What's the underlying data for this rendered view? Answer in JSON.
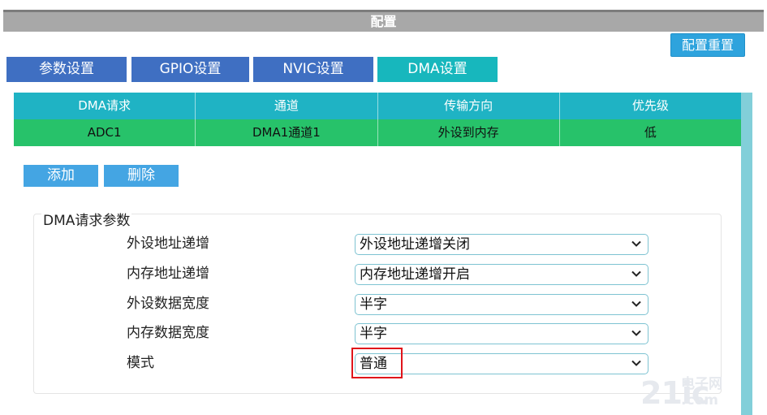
{
  "window": {
    "title": "配置"
  },
  "toolbar": {
    "reset_label": "配置重置"
  },
  "tabs": [
    {
      "label": "参数设置",
      "active": false
    },
    {
      "label": "GPIO设置",
      "active": false
    },
    {
      "label": "NVIC设置",
      "active": false
    },
    {
      "label": "DMA设置",
      "active": true
    }
  ],
  "dma_table": {
    "columns": [
      "DMA请求",
      "通道",
      "传输方向",
      "优先级"
    ],
    "rows": [
      [
        "ADC1",
        "DMA1通道1",
        "外设到内存",
        "低"
      ]
    ]
  },
  "actions": {
    "add_label": "添加",
    "delete_label": "删除"
  },
  "params": {
    "legend": "DMA请求参数",
    "fields": [
      {
        "label": "外设地址递增",
        "value": "外设地址递增关闭"
      },
      {
        "label": "内存地址递增",
        "value": "内存地址递增开启"
      },
      {
        "label": "外设数据宽度",
        "value": "半字"
      },
      {
        "label": "内存数据宽度",
        "value": "半字"
      },
      {
        "label": "模式",
        "value": "普通"
      }
    ]
  },
  "colors": {
    "tab_inactive": "#3f6fc2",
    "tab_active": "#17b7bd",
    "table_header": "#1fb3c4",
    "row_selected": "#27c26a",
    "highlight": "#e0141b"
  }
}
